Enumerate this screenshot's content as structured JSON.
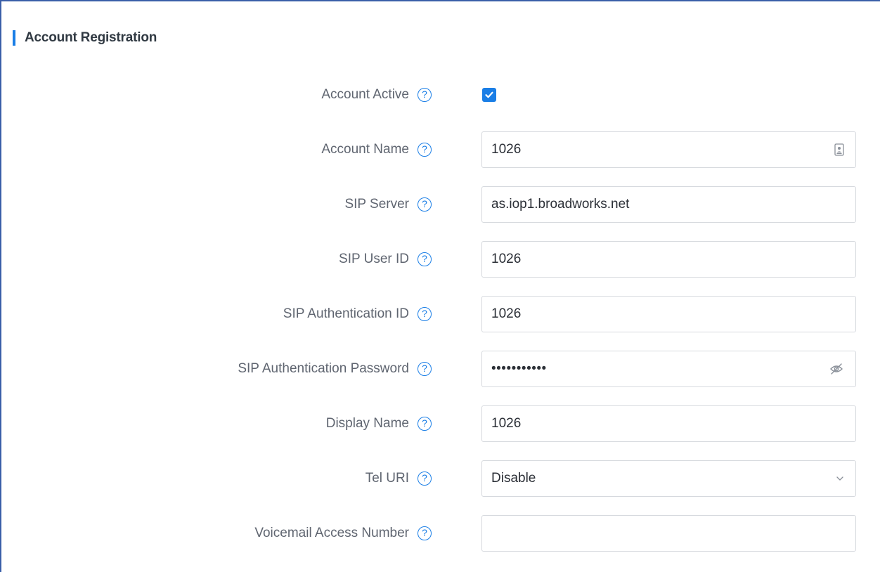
{
  "section": {
    "title": "Account Registration"
  },
  "fields": {
    "account_active": {
      "label": "Account Active",
      "checked": true
    },
    "account_name": {
      "label": "Account Name",
      "value": "1026"
    },
    "sip_server": {
      "label": "SIP Server",
      "value": "as.iop1.broadworks.net"
    },
    "sip_user_id": {
      "label": "SIP User ID",
      "value": "1026"
    },
    "sip_auth_id": {
      "label": "SIP Authentication ID",
      "value": "1026"
    },
    "sip_auth_password": {
      "label": "SIP Authentication Password",
      "value": "•••••••••••"
    },
    "display_name": {
      "label": "Display Name",
      "value": "1026"
    },
    "tel_uri": {
      "label": "Tel URI",
      "value": "Disable"
    },
    "voicemail_access_number": {
      "label": "Voicemail Access Number",
      "value": ""
    }
  },
  "help_glyph": "?",
  "icons": {
    "help": "question-circle-icon",
    "checkbox": "checkmark-icon",
    "contact_card": "contact-card-icon",
    "password_toggle": "eye-slash-icon",
    "dropdown": "chevron-down-icon"
  },
  "colors": {
    "accent": "#1a7ee6",
    "label": "#5f6570",
    "value": "#2b2f36",
    "border": "#d6d9de",
    "frame": "#3a5fa8"
  }
}
